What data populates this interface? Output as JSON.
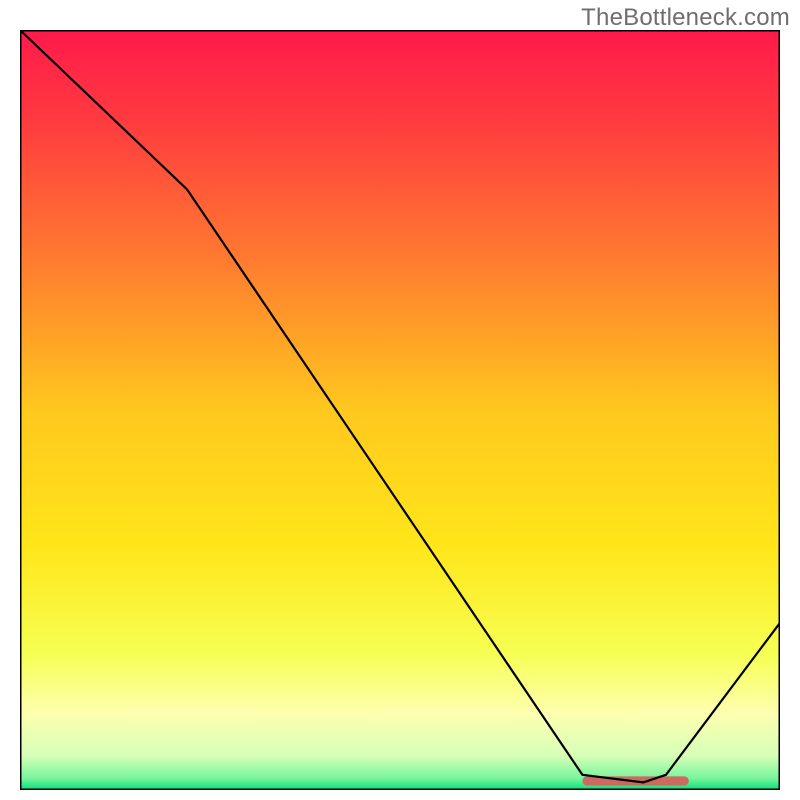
{
  "watermark": "TheBottleneck.com",
  "chart_data": {
    "type": "line",
    "title": "",
    "xlabel": "",
    "ylabel": "",
    "xlim": [
      0,
      100
    ],
    "ylim": [
      0,
      100
    ],
    "x": [
      0,
      22,
      74,
      82,
      85,
      100
    ],
    "values": [
      100,
      79,
      2,
      1,
      2,
      22
    ],
    "marker_band": {
      "x0": 74,
      "x1": 88,
      "y": 1.2,
      "height": 1.2
    },
    "gradient_stops": [
      {
        "offset": 0.0,
        "color": "#ff1a4b"
      },
      {
        "offset": 0.12,
        "color": "#ff3b3f"
      },
      {
        "offset": 0.3,
        "color": "#ff7a30"
      },
      {
        "offset": 0.5,
        "color": "#ffc81e"
      },
      {
        "offset": 0.68,
        "color": "#ffe61a"
      },
      {
        "offset": 0.82,
        "color": "#f6ff52"
      },
      {
        "offset": 0.9,
        "color": "#fdffb0"
      },
      {
        "offset": 0.955,
        "color": "#d6ffb8"
      },
      {
        "offset": 0.985,
        "color": "#77f59c"
      },
      {
        "offset": 1.0,
        "color": "#00e07a"
      }
    ],
    "frame_color": "#000000",
    "line_color": "#000000",
    "marker_color": "#cc6a60"
  }
}
